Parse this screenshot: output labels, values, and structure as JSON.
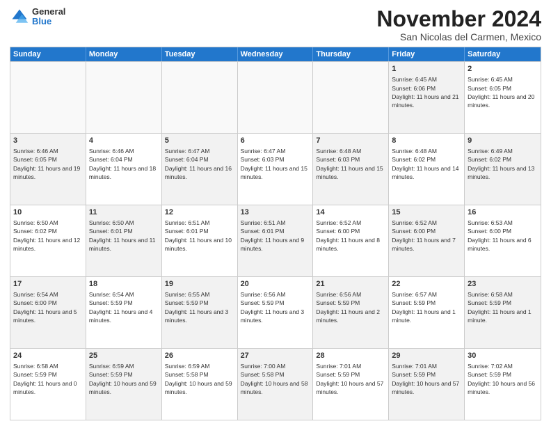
{
  "logo": {
    "general": "General",
    "blue": "Blue",
    "icon_color": "#2277cc"
  },
  "title": {
    "month": "November 2024",
    "location": "San Nicolas del Carmen, Mexico"
  },
  "calendar": {
    "headers": [
      "Sunday",
      "Monday",
      "Tuesday",
      "Wednesday",
      "Thursday",
      "Friday",
      "Saturday"
    ],
    "weeks": [
      [
        {
          "day": "",
          "empty": true
        },
        {
          "day": "",
          "empty": true
        },
        {
          "day": "",
          "empty": true
        },
        {
          "day": "",
          "empty": true
        },
        {
          "day": "",
          "empty": true
        },
        {
          "day": "1",
          "text": "Sunrise: 6:45 AM\nSunset: 6:06 PM\nDaylight: 11 hours and 21 minutes.",
          "shaded": true
        },
        {
          "day": "2",
          "text": "Sunrise: 6:45 AM\nSunset: 6:05 PM\nDaylight: 11 hours and 20 minutes.",
          "shaded": false
        }
      ],
      [
        {
          "day": "3",
          "text": "Sunrise: 6:46 AM\nSunset: 6:05 PM\nDaylight: 11 hours and 19 minutes.",
          "shaded": true
        },
        {
          "day": "4",
          "text": "Sunrise: 6:46 AM\nSunset: 6:04 PM\nDaylight: 11 hours and 18 minutes.",
          "shaded": false
        },
        {
          "day": "5",
          "text": "Sunrise: 6:47 AM\nSunset: 6:04 PM\nDaylight: 11 hours and 16 minutes.",
          "shaded": true
        },
        {
          "day": "6",
          "text": "Sunrise: 6:47 AM\nSunset: 6:03 PM\nDaylight: 11 hours and 15 minutes.",
          "shaded": false
        },
        {
          "day": "7",
          "text": "Sunrise: 6:48 AM\nSunset: 6:03 PM\nDaylight: 11 hours and 15 minutes.",
          "shaded": true
        },
        {
          "day": "8",
          "text": "Sunrise: 6:48 AM\nSunset: 6:02 PM\nDaylight: 11 hours and 14 minutes.",
          "shaded": false
        },
        {
          "day": "9",
          "text": "Sunrise: 6:49 AM\nSunset: 6:02 PM\nDaylight: 11 hours and 13 minutes.",
          "shaded": true
        }
      ],
      [
        {
          "day": "10",
          "text": "Sunrise: 6:50 AM\nSunset: 6:02 PM\nDaylight: 11 hours and 12 minutes.",
          "shaded": false
        },
        {
          "day": "11",
          "text": "Sunrise: 6:50 AM\nSunset: 6:01 PM\nDaylight: 11 hours and 11 minutes.",
          "shaded": true
        },
        {
          "day": "12",
          "text": "Sunrise: 6:51 AM\nSunset: 6:01 PM\nDaylight: 11 hours and 10 minutes.",
          "shaded": false
        },
        {
          "day": "13",
          "text": "Sunrise: 6:51 AM\nSunset: 6:01 PM\nDaylight: 11 hours and 9 minutes.",
          "shaded": true
        },
        {
          "day": "14",
          "text": "Sunrise: 6:52 AM\nSunset: 6:00 PM\nDaylight: 11 hours and 8 minutes.",
          "shaded": false
        },
        {
          "day": "15",
          "text": "Sunrise: 6:52 AM\nSunset: 6:00 PM\nDaylight: 11 hours and 7 minutes.",
          "shaded": true
        },
        {
          "day": "16",
          "text": "Sunrise: 6:53 AM\nSunset: 6:00 PM\nDaylight: 11 hours and 6 minutes.",
          "shaded": false
        }
      ],
      [
        {
          "day": "17",
          "text": "Sunrise: 6:54 AM\nSunset: 6:00 PM\nDaylight: 11 hours and 5 minutes.",
          "shaded": true
        },
        {
          "day": "18",
          "text": "Sunrise: 6:54 AM\nSunset: 5:59 PM\nDaylight: 11 hours and 4 minutes.",
          "shaded": false
        },
        {
          "day": "19",
          "text": "Sunrise: 6:55 AM\nSunset: 5:59 PM\nDaylight: 11 hours and 3 minutes.",
          "shaded": true
        },
        {
          "day": "20",
          "text": "Sunrise: 6:56 AM\nSunset: 5:59 PM\nDaylight: 11 hours and 3 minutes.",
          "shaded": false
        },
        {
          "day": "21",
          "text": "Sunrise: 6:56 AM\nSunset: 5:59 PM\nDaylight: 11 hours and 2 minutes.",
          "shaded": true
        },
        {
          "day": "22",
          "text": "Sunrise: 6:57 AM\nSunset: 5:59 PM\nDaylight: 11 hours and 1 minute.",
          "shaded": false
        },
        {
          "day": "23",
          "text": "Sunrise: 6:58 AM\nSunset: 5:59 PM\nDaylight: 11 hours and 1 minute.",
          "shaded": true
        }
      ],
      [
        {
          "day": "24",
          "text": "Sunrise: 6:58 AM\nSunset: 5:59 PM\nDaylight: 11 hours and 0 minutes.",
          "shaded": false
        },
        {
          "day": "25",
          "text": "Sunrise: 6:59 AM\nSunset: 5:59 PM\nDaylight: 10 hours and 59 minutes.",
          "shaded": true
        },
        {
          "day": "26",
          "text": "Sunrise: 6:59 AM\nSunset: 5:58 PM\nDaylight: 10 hours and 59 minutes.",
          "shaded": false
        },
        {
          "day": "27",
          "text": "Sunrise: 7:00 AM\nSunset: 5:58 PM\nDaylight: 10 hours and 58 minutes.",
          "shaded": true
        },
        {
          "day": "28",
          "text": "Sunrise: 7:01 AM\nSunset: 5:59 PM\nDaylight: 10 hours and 57 minutes.",
          "shaded": false
        },
        {
          "day": "29",
          "text": "Sunrise: 7:01 AM\nSunset: 5:59 PM\nDaylight: 10 hours and 57 minutes.",
          "shaded": true
        },
        {
          "day": "30",
          "text": "Sunrise: 7:02 AM\nSunset: 5:59 PM\nDaylight: 10 hours and 56 minutes.",
          "shaded": false
        }
      ]
    ]
  }
}
